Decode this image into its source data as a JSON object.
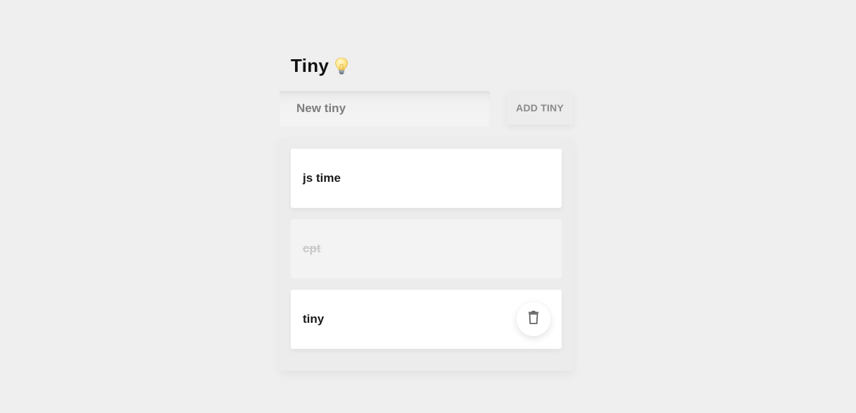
{
  "header": {
    "title": "Tiny",
    "icon": "lightbulb-icon"
  },
  "form": {
    "input_placeholder": "New tiny",
    "input_value": "",
    "add_label": "ADD TINY"
  },
  "todos": [
    {
      "label": "js time",
      "done": false
    },
    {
      "label": "cpt",
      "done": true
    },
    {
      "label": "tiny",
      "done": false,
      "hovered": true
    }
  ],
  "icons": {
    "delete": "trash-icon"
  },
  "colors": {
    "background": "#efefef",
    "card": "#ffffff",
    "done_card": "#f3f3f4",
    "done_text": "#c8c8c8",
    "button_text": "#8a8a8a"
  }
}
